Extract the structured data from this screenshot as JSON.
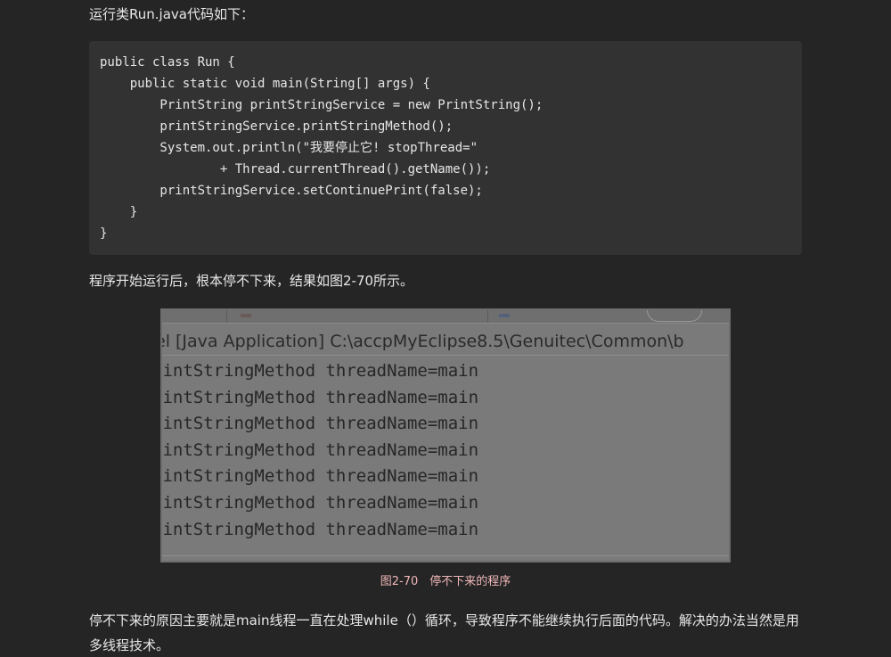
{
  "intro_text": "运行类Run.java代码如下：",
  "code_lines": [
    "public class Run {",
    "    public static void main(String[] args) {",
    "        PrintString printStringService = new PrintString();",
    "        printStringService.printStringMethod();",
    "        System.out.println(\"我要停止它! stopThread=\"",
    "                + Thread.currentThread().getName());",
    "        printStringService.setContinuePrint(false);",
    "    }",
    "}"
  ],
  "paragraph_1": "程序开始运行后，根本停不下来，结果如图2-70所示。",
  "figure": {
    "console_header": "el [Java Application] C:\\accpMyEclipse8.5\\Genuitec\\Common\\b",
    "console_lines": [
      "rintStringMethod threadName=main",
      "rintStringMethod threadName=main",
      "rintStringMethod threadName=main",
      "rintStringMethod threadName=main",
      "rintStringMethod threadName=main",
      "rintStringMethod threadName=main",
      "rintStringMethod threadName=main"
    ],
    "caption": "图2-70　停不下来的程序"
  },
  "paragraph_2": "停不下来的原因主要就是main线程一直在处理while（）循环，导致程序不能继续执行后面的代码。解决的办法当然是用多线程技术。",
  "colors": {
    "background": "#252526",
    "code_background": "#323232",
    "caption": "#f0b6b6"
  }
}
